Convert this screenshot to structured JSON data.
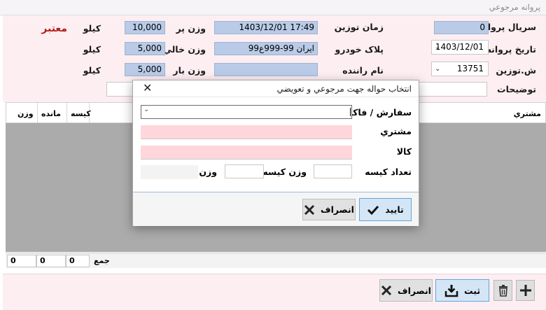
{
  "window": {
    "title": "پروانه مرجوعي"
  },
  "form": {
    "serial_label": "سريال پروانه",
    "serial_value": "0",
    "date_label": "تاريخ پروانه",
    "date_value": "1403/12/01",
    "weigh_no_label": "ش.توزين",
    "weigh_no_value": "13751",
    "desc_label": "توضيحات",
    "weigh_time_label": "زمان توزين",
    "weigh_time_value": "1403/12/01   17:49",
    "plate_label": "پلاک خودرو",
    "plate_value": "ايران 99-999ع99",
    "driver_label": "نام راننده",
    "driver_value": "",
    "full_weight_label": "وزن پر",
    "full_weight_value": "10,000",
    "empty_weight_label": "وزن خالي",
    "empty_weight_value": "5,000",
    "load_weight_label": "وزن بار",
    "load_weight_value": "5,000",
    "unit": "کيلو",
    "status": "معتبر"
  },
  "grid": {
    "columns": {
      "customer": "مشتري",
      "bag": "کيسه",
      "remain": "مانده",
      "weight": "وزن"
    },
    "totals_label": "جمع",
    "totals": {
      "bag": "0",
      "remain": "0",
      "weight": "0"
    }
  },
  "toolbar": {
    "cancel_label": "انصراف",
    "save_label": "ثبت"
  },
  "dialog": {
    "title": "انتخاب حواله جهت مرجوعي و تعويضي",
    "order_label": "سفارش / فاکتور",
    "customer_label": "مشتري",
    "goods_label": "کالا",
    "bag_count_label": "تعداد کيسه",
    "bag_weight_label": "وزن کيسه",
    "weight_label": "وزن",
    "confirm_label": "تاييد",
    "cancel_label": "انصراف"
  }
}
